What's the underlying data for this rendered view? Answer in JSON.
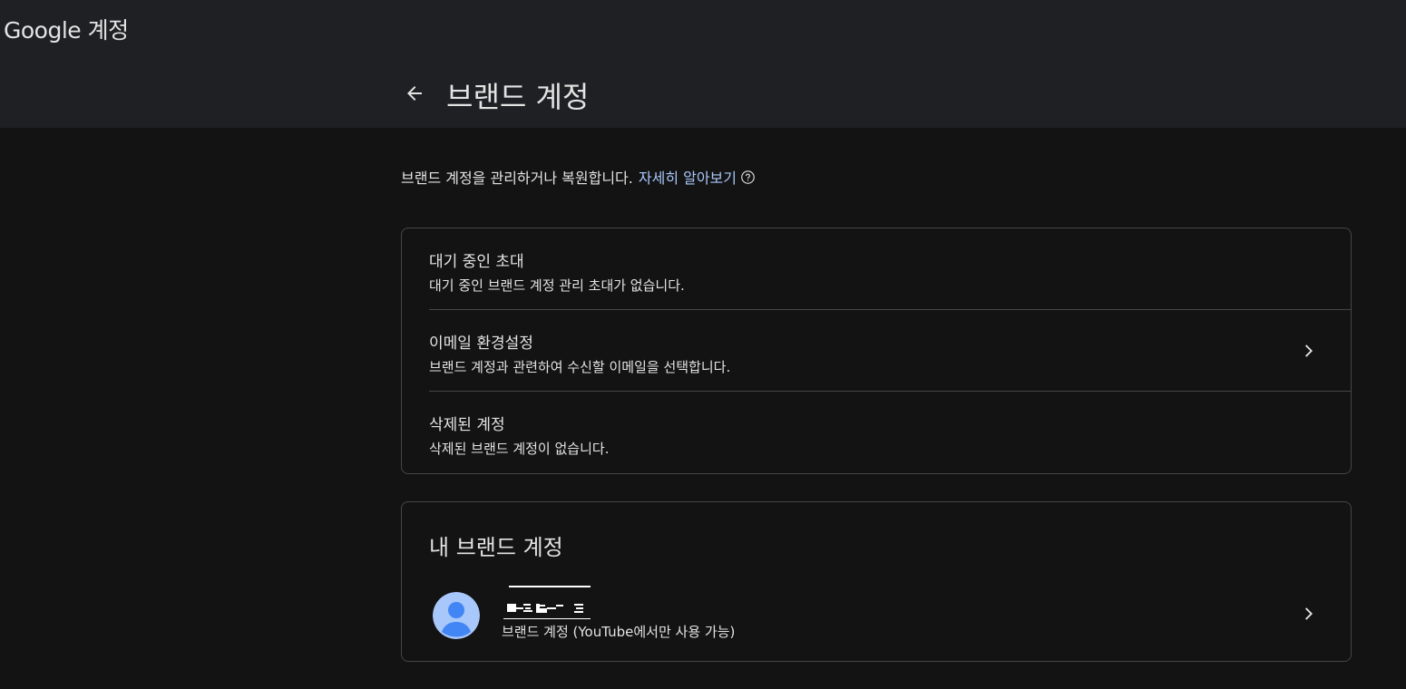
{
  "header": {
    "logo_text": "Google 계정",
    "page_title": "브랜드 계정"
  },
  "intro": {
    "text": "브랜드 계정을 관리하거나 복원합니다.",
    "link_text": "자세히 알아보기"
  },
  "settings": [
    {
      "title": "대기 중인 초대",
      "subtitle": "대기 중인 브랜드 계정 관리 초대가 없습니다."
    },
    {
      "title": "이메일 환경설정",
      "subtitle": "브랜드 계정과 관련하여 수신할 이메일을 선택합니다."
    },
    {
      "title": "삭제된 계정",
      "subtitle": "삭제된 브랜드 계정이 없습니다."
    }
  ],
  "my_brand_accounts": {
    "title": "내 브랜드 계정",
    "accounts": [
      {
        "subtitle": "브랜드 계정 (YouTube에서만 사용 가능)"
      }
    ]
  },
  "colors": {
    "background": "#131314",
    "header_background": "#1f2023",
    "text": "#e3e3e3",
    "link": "#a8c7fa",
    "border": "#444746",
    "avatar_bg": "#a8c7fa",
    "avatar_fg": "#4285f4"
  },
  "icons": {
    "back": "arrow-back-icon",
    "help": "help-circle-icon",
    "chevron": "chevron-right-icon",
    "avatar": "person-avatar-icon"
  }
}
